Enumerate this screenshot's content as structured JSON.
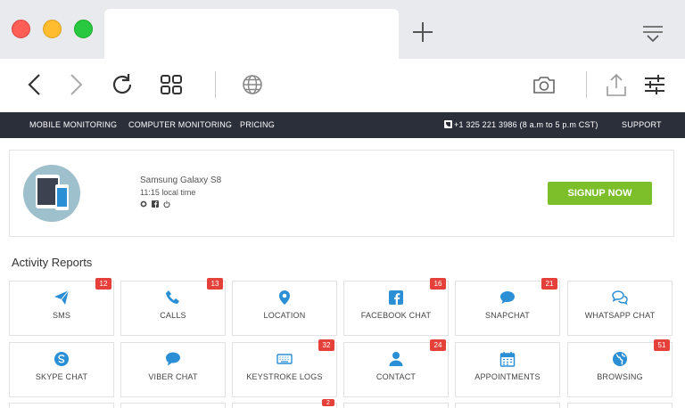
{
  "browser": {
    "window_buttons": [
      "close",
      "minimize",
      "maximize"
    ],
    "tab_title": "",
    "icons": [
      "back-icon",
      "forward-icon",
      "reload-icon",
      "grid-icon",
      "globe-icon",
      "camera-icon",
      "share-icon",
      "settings-sliders-icon"
    ]
  },
  "nav": {
    "mobile": "MOBILE MONITORING",
    "computer": "COMPUTER MONITORING",
    "pricing": "PRICING",
    "phone": "+1 325 221 3986 (8 a.m to 5 p.m CST)",
    "support": "SUPPORT"
  },
  "device": {
    "name": "Samsung Galaxy S8",
    "time": "11:15 local time",
    "signup": "SIGNUP NOW"
  },
  "reports": {
    "title": "Activity Reports",
    "tiles": [
      {
        "label": "SMS",
        "badge": "12",
        "icon": "send-icon"
      },
      {
        "label": "CALLS",
        "badge": "13",
        "icon": "phone-icon"
      },
      {
        "label": "LOCATION",
        "badge": "",
        "icon": "map-pin-icon"
      },
      {
        "label": "FACEBOOK CHAT",
        "badge": "16",
        "icon": "facebook-icon"
      },
      {
        "label": "SNAPCHAT",
        "badge": "21",
        "icon": "chat-bubble-icon"
      },
      {
        "label": "WHATSAPP CHAT",
        "badge": "",
        "icon": "chat-bubbles-icon"
      },
      {
        "label": "SKYPE CHAT",
        "badge": "",
        "icon": "skype-icon"
      },
      {
        "label": "VIBER CHAT",
        "badge": "",
        "icon": "comment-icon"
      },
      {
        "label": "KEYSTROKE LOGS",
        "badge": "32",
        "icon": "keyboard-icon"
      },
      {
        "label": "CONTACT",
        "badge": "24",
        "icon": "user-icon"
      },
      {
        "label": "APPOINTMENTS",
        "badge": "",
        "icon": "calendar-icon"
      },
      {
        "label": "BROWSING",
        "badge": "51",
        "icon": "globe-icon"
      }
    ],
    "partial_badge": "2"
  },
  "colors": {
    "accent_blue": "#2a8fd4",
    "signup_green": "#7cbf2b",
    "badge_red": "#e6403a",
    "nav_dark": "#2b2f3a"
  }
}
